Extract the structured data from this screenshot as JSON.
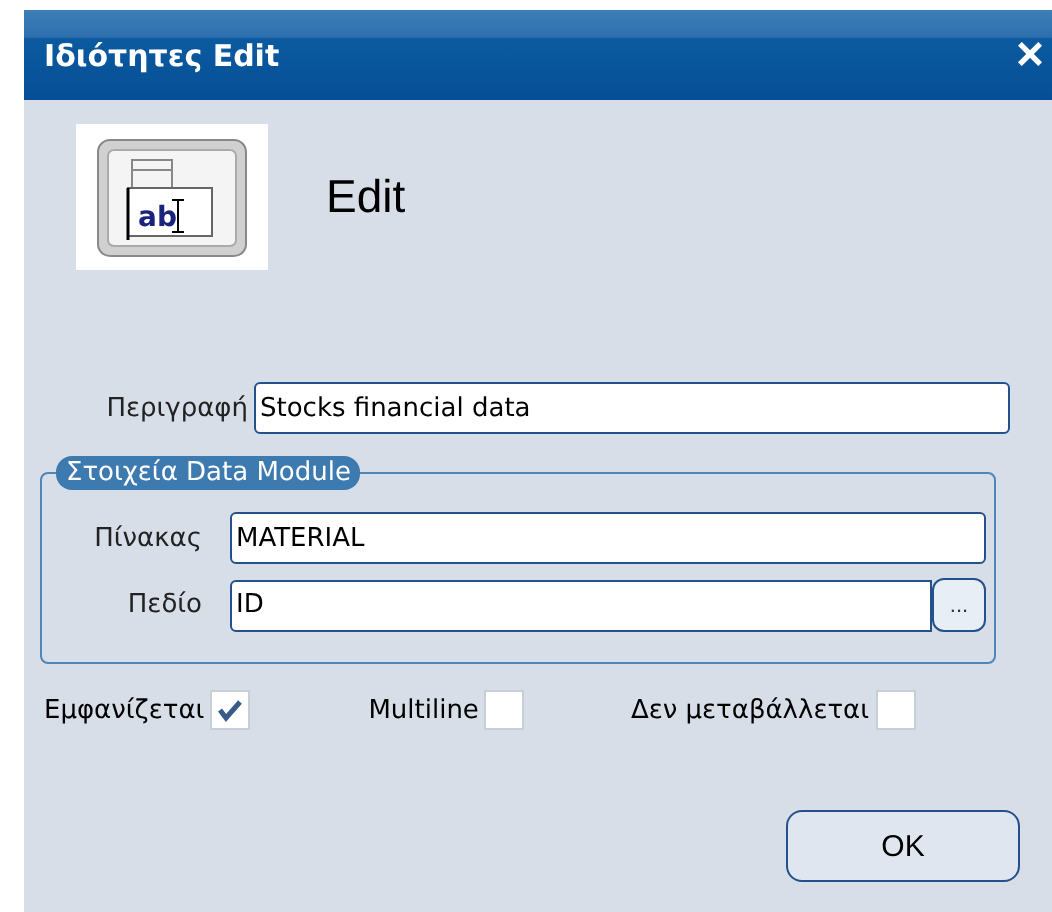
{
  "window": {
    "title": "Ιδιότητες Edit",
    "close": "×"
  },
  "header": {
    "icon_text": "ab",
    "title": "Edit"
  },
  "description": {
    "label": "Περιγραφή",
    "value": "Stocks financial data"
  },
  "group": {
    "legend": "Στοιχεία Data Module",
    "fields": [
      {
        "label": "Πίνακας",
        "value": "MATERIAL"
      },
      {
        "label": "Πεδίο",
        "value": "ID",
        "button": "..."
      }
    ]
  },
  "checkboxes": [
    {
      "label": "Εμφανίζεται",
      "checked": true
    },
    {
      "label": "Multiline",
      "checked": false
    },
    {
      "label": "Δεν μεταβάλλεται",
      "checked": false
    }
  ],
  "buttons": [
    "OK"
  ]
}
